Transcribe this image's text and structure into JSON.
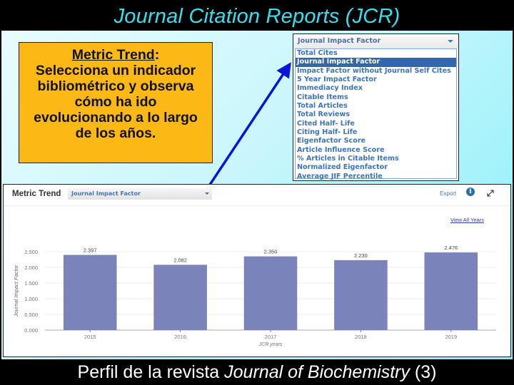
{
  "slide": {
    "title": "Journal Citation Reports (JCR)",
    "caption_prefix": "Perfil de la revista ",
    "caption_italic": "Journal of Biochemistry",
    "caption_suffix": " (3)"
  },
  "callout": {
    "heading": "Metric Trend",
    "heading_colon": ":",
    "lines": [
      "Selecciona un indicador",
      "bibliométrico y observa",
      "cómo ha ido",
      "evolucionando a lo largo",
      "de los años."
    ]
  },
  "dropdown": {
    "selected": "Journal Impact Factor",
    "options": [
      "Total Cites",
      "Journal Impact Factor",
      "Impact Factor without Journal Self Cites",
      "5 Year Impact Factor",
      "Immediacy Index",
      "Citable Items",
      "Total Articles",
      "Total Reviews",
      "Cited Half- Life",
      "Citing Half- Life",
      "Eigenfactor Score",
      "Article Influence Score",
      "% Articles in Citable Items",
      "Normalized Eigenfactor",
      "Average JIF Percentile"
    ],
    "highlighted_index": 1
  },
  "panel": {
    "title": "Metric Trend",
    "selected_metric": "Journal Impact Factor",
    "export_label": "Export",
    "info_icon": "info-icon",
    "expand_icon": "expand-icon",
    "view_all_label": "View All Years"
  },
  "colors": {
    "bar": "#7a84bb",
    "title_text": "#33e0f0",
    "callout_bg": "#fcb814",
    "arrow": "#0a14d8",
    "dropdown_highlight": "#3466ae"
  },
  "chart_data": {
    "type": "bar",
    "categories": [
      "2015",
      "2016",
      "2017",
      "2018",
      "2019"
    ],
    "values": [
      2.397,
      2.082,
      2.35,
      2.23,
      2.476
    ],
    "value_labels": [
      "2.397",
      "2.082",
      "2.350",
      "2.230",
      "2.476"
    ],
    "title": "",
    "xlabel": "JCR years",
    "ylabel": "Journal Impact Factor",
    "ylim": [
      0,
      2.5
    ],
    "yticks": [
      0,
      0.5,
      1.0,
      1.5,
      2.0,
      2.5
    ],
    "ytick_labels": [
      "0.000",
      "0.500",
      "1.000",
      "1.500",
      "2.000",
      "2.500"
    ],
    "grid": true,
    "legend": "none"
  }
}
